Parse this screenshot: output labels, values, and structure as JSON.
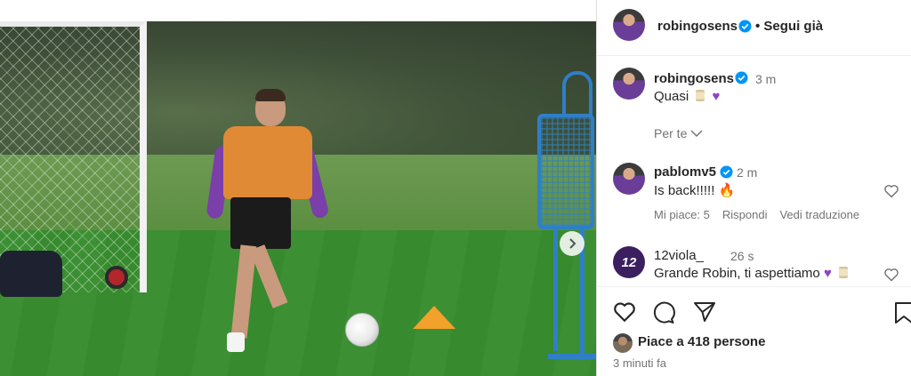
{
  "post": {
    "author": "robingosens",
    "follow_status": "• Segui già"
  },
  "caption": {
    "author": "robingosens",
    "time": "3 m",
    "text": "Quasi",
    "see_translation": "Per te"
  },
  "comments": [
    {
      "author": "pablomv5",
      "time": "2 m",
      "text": "Is back!!!!!",
      "likes_label": "Mi piace: 5",
      "reply_label": "Rispondi",
      "translate_label": "Vedi traduzione"
    },
    {
      "author": "12viola_",
      "time": "26 s",
      "text": "Grande Robin, ti aspettiamo"
    }
  ],
  "likes_summary": "Piace a 418 persone",
  "posted_ago": "3 minuti fa",
  "avatar_badge_12viola": "12",
  "icons": {
    "like": "heart-outline-icon",
    "comment": "comment-bubble-icon",
    "share": "paper-plane-icon",
    "save": "bookmark-icon",
    "verified": "verified-badge-icon",
    "next": "chevron-right-icon"
  },
  "colors": {
    "verified_blue": "#0095f6",
    "text": "#262626",
    "muted": "#737373"
  }
}
